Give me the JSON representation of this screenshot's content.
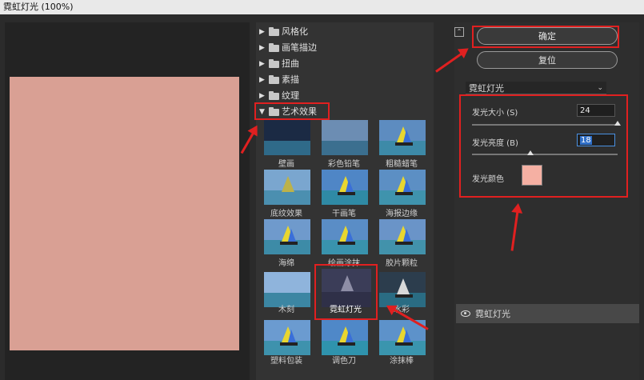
{
  "window": {
    "title": "霓虹灯光 (100%)"
  },
  "preview": {
    "color": "#d9a094"
  },
  "categories": [
    {
      "label": "风格化",
      "expanded": false
    },
    {
      "label": "画笔描边",
      "expanded": false
    },
    {
      "label": "扭曲",
      "expanded": false
    },
    {
      "label": "素描",
      "expanded": false
    },
    {
      "label": "纹理",
      "expanded": false
    },
    {
      "label": "艺术效果",
      "expanded": true
    }
  ],
  "filters": [
    {
      "label": "壁画"
    },
    {
      "label": "彩色铅笔"
    },
    {
      "label": "粗糙蜡笔"
    },
    {
      "label": "底纹效果"
    },
    {
      "label": "干画笔"
    },
    {
      "label": "海报边缘"
    },
    {
      "label": "海绵"
    },
    {
      "label": "绘画涂抹"
    },
    {
      "label": "胶片颗粒"
    },
    {
      "label": "木刻"
    },
    {
      "label": "霓虹灯光",
      "selected": true
    },
    {
      "label": "水彩"
    },
    {
      "label": "塑料包装"
    },
    {
      "label": "调色刀"
    },
    {
      "label": "涂抹棒"
    }
  ],
  "buttons": {
    "ok": "确定",
    "reset": "复位"
  },
  "filter_dropdown": {
    "value": "霓虹灯光"
  },
  "params": {
    "glow_size": {
      "label": "发光大小 (S)",
      "value": "24",
      "slider": 1.0
    },
    "glow_brightness": {
      "label": "发光亮度 (B)",
      "value": "18",
      "slider": 0.4
    },
    "glow_color": {
      "label": "发光颜色",
      "color": "#f5b0a3"
    }
  },
  "layers": [
    {
      "label": "霓虹灯光"
    }
  ],
  "colors": {
    "annotation": "#e02020",
    "accent": "#2f6fc9"
  }
}
